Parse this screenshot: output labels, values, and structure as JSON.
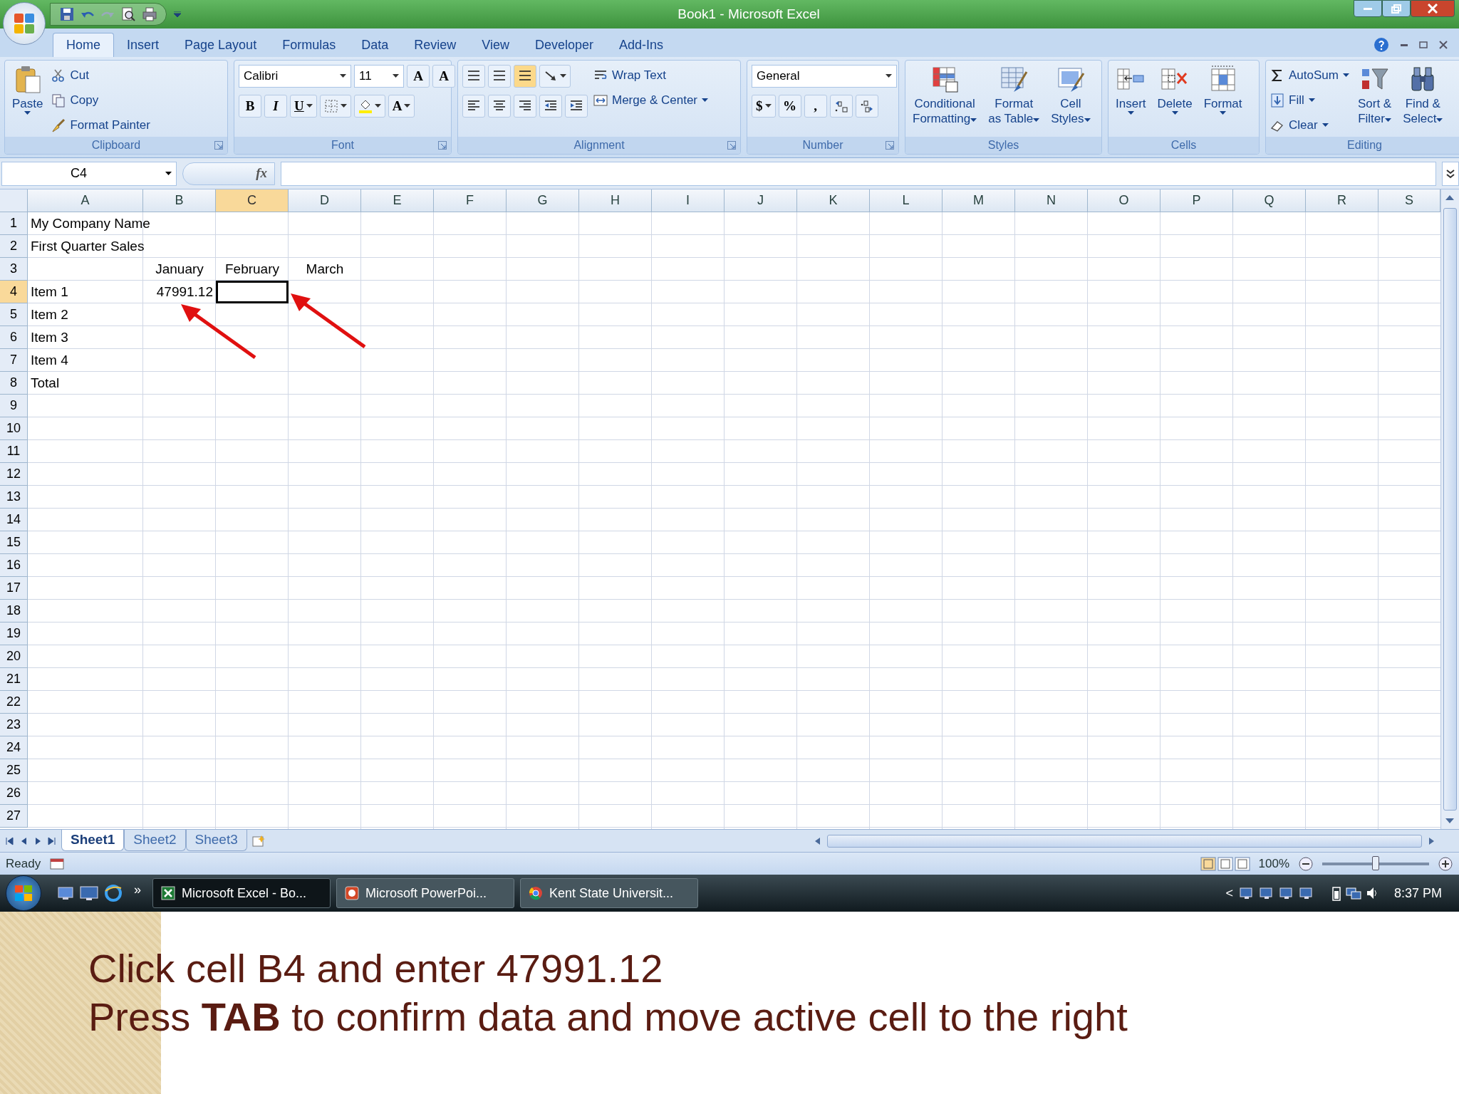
{
  "window": {
    "title": "Book1 - Microsoft Excel"
  },
  "tabs": [
    {
      "label": "Home",
      "selected": true
    },
    {
      "label": "Insert",
      "selected": false
    },
    {
      "label": "Page Layout",
      "selected": false
    },
    {
      "label": "Formulas",
      "selected": false
    },
    {
      "label": "Data",
      "selected": false
    },
    {
      "label": "Review",
      "selected": false
    },
    {
      "label": "View",
      "selected": false
    },
    {
      "label": "Developer",
      "selected": false
    },
    {
      "label": "Add-Ins",
      "selected": false
    }
  ],
  "ribbon": [
    {
      "label": "Clipboard",
      "launcher": true,
      "sections": [
        {
          "kind": "large",
          "lines": [
            "Paste"
          ],
          "dropdown": true
        },
        {
          "kind": "stack",
          "items": [
            {
              "label": "Cut",
              "dropdown": false
            },
            {
              "label": "Copy",
              "dropdown": false
            },
            {
              "label": "Format Painter",
              "dropdown": false
            }
          ]
        }
      ]
    },
    {
      "label": "Font",
      "launcher": true,
      "sections": [
        {
          "kind": "lines",
          "lines": [
            {
              "items": [
                {
                  "kind": "font-field",
                  "value": "Calibri"
                },
                {
                  "kind": "size-field",
                  "value": "11"
                },
                {
                  "kind": "glyph",
                  "text": "A",
                  "dropdown": false,
                  "selected": false
                },
                {
                  "kind": "glyph",
                  "text": "A",
                  "dropdown": false,
                  "selected": false
                }
              ]
            },
            {
              "items": [
                {
                  "kind": "glyph",
                  "text": "B",
                  "dropdown": false,
                  "selected": false
                },
                {
                  "kind": "glyph",
                  "text": "I",
                  "dropdown": false,
                  "selected": false
                },
                {
                  "kind": "glyph",
                  "text": "U",
                  "dropdown": true,
                  "selected": false
                },
                {
                  "kind": "icon",
                  "dropdown": true,
                  "selected": false
                },
                {
                  "kind": "icon",
                  "dropdown": true,
                  "selected": false
                },
                {
                  "kind": "glyph",
                  "text": "A",
                  "dropdown": true,
                  "selected": false
                }
              ]
            }
          ]
        }
      ]
    },
    {
      "label": "Alignment",
      "launcher": true,
      "sections": [
        {
          "kind": "lines",
          "lines": [
            {
              "items": [
                {
                  "kind": "icon",
                  "dropdown": false,
                  "selected": false
                },
                {
                  "kind": "icon",
                  "dropdown": false,
                  "selected": false
                },
                {
                  "kind": "icon",
                  "dropdown": false,
                  "selected": true
                },
                {
                  "kind": "icon",
                  "dropdown": true,
                  "selected": false
                }
              ]
            },
            {
              "items": [
                {
                  "kind": "icon",
                  "dropdown": false,
                  "selected": false
                },
                {
                  "kind": "icon",
                  "dropdown": false,
                  "selected": false
                },
                {
                  "kind": "icon",
                  "dropdown": false,
                  "selected": false
                },
                {
                  "kind": "icon",
                  "dropdown": false,
                  "selected": false
                },
                {
                  "kind": "icon",
                  "dropdown": false,
                  "selected": false
                }
              ]
            }
          ]
        },
        {
          "kind": "stack",
          "items": [
            {
              "label": "Wrap Text",
              "dropdown": false
            },
            {
              "label": "Merge & Center",
              "dropdown": true
            }
          ]
        }
      ]
    },
    {
      "label": "Number",
      "launcher": true,
      "sections": [
        {
          "kind": "lines",
          "lines": [
            {
              "items": [
                {
                  "kind": "format-field",
                  "value": "General"
                }
              ]
            },
            {
              "items": [
                {
                  "kind": "glyph",
                  "text": "$",
                  "dropdown": true,
                  "selected": false
                },
                {
                  "kind": "glyph",
                  "text": "%",
                  "dropdown": false,
                  "selected": false
                },
                {
                  "kind": "glyph",
                  "text": ",",
                  "dropdown": false,
                  "selected": false
                },
                {
                  "kind": "icon",
                  "dropdown": false,
                  "selected": false
                },
                {
                  "kind": "icon",
                  "dropdown": false,
                  "selected": false
                }
              ]
            }
          ]
        }
      ]
    },
    {
      "label": "Styles",
      "launcher": false,
      "sections": [
        {
          "kind": "large",
          "lines": [
            "Conditional",
            "Formatting"
          ],
          "dropdown": true
        },
        {
          "kind": "large",
          "lines": [
            "Format",
            "as Table"
          ],
          "dropdown": true
        },
        {
          "kind": "large",
          "lines": [
            "Cell",
            "Styles"
          ],
          "dropdown": true
        }
      ]
    },
    {
      "label": "Cells",
      "launcher": false,
      "sections": [
        {
          "kind": "large",
          "lines": [
            "Insert"
          ],
          "dropdown": true
        },
        {
          "kind": "large",
          "lines": [
            "Delete"
          ],
          "dropdown": true
        },
        {
          "kind": "large",
          "lines": [
            "Format"
          ],
          "dropdown": true
        }
      ]
    },
    {
      "label": "Editing",
      "launcher": false,
      "sections": [
        {
          "kind": "stack",
          "items": [
            {
              "label": "AutoSum",
              "dropdown": true
            },
            {
              "label": "Fill",
              "dropdown": true
            },
            {
              "label": "Clear",
              "dropdown": true
            }
          ]
        },
        {
          "kind": "large",
          "lines": [
            "Sort &",
            "Filter"
          ],
          "dropdown": true
        },
        {
          "kind": "large",
          "lines": [
            "Find &",
            "Select"
          ],
          "dropdown": true
        }
      ]
    }
  ],
  "formula_bar": {
    "name_box": "C4",
    "fx": "fx"
  },
  "columns": [
    {
      "label": "A",
      "selected": false
    },
    {
      "label": "B",
      "selected": false
    },
    {
      "label": "C",
      "selected": true
    },
    {
      "label": "D",
      "selected": false
    },
    {
      "label": "E",
      "selected": false
    },
    {
      "label": "F",
      "selected": false
    },
    {
      "label": "G",
      "selected": false
    },
    {
      "label": "H",
      "selected": false
    },
    {
      "label": "I",
      "selected": false
    },
    {
      "label": "J",
      "selected": false
    },
    {
      "label": "K",
      "selected": false
    },
    {
      "label": "L",
      "selected": false
    },
    {
      "label": "M",
      "selected": false
    },
    {
      "label": "N",
      "selected": false
    },
    {
      "label": "O",
      "selected": false
    },
    {
      "label": "P",
      "selected": false
    },
    {
      "label": "Q",
      "selected": false
    },
    {
      "label": "R",
      "selected": false
    },
    {
      "label": "S",
      "selected": false
    }
  ],
  "rows": [
    {
      "label": "1",
      "selected": false,
      "cells": {
        "A": {
          "text": "My Company Name"
        }
      }
    },
    {
      "label": "2",
      "selected": false,
      "cells": {
        "A": {
          "text": "First Quarter Sales"
        }
      }
    },
    {
      "label": "3",
      "selected": false,
      "cells": {
        "B": {
          "text": "January",
          "kind": "heading"
        },
        "C": {
          "text": "February",
          "kind": "heading"
        },
        "D": {
          "text": "March",
          "kind": "heading"
        }
      }
    },
    {
      "label": "4",
      "selected": true,
      "cells": {
        "A": {
          "text": "Item 1"
        },
        "B": {
          "text": "47991.12",
          "kind": "number"
        }
      }
    },
    {
      "label": "5",
      "selected": false,
      "cells": {
        "A": {
          "text": "Item 2"
        }
      }
    },
    {
      "label": "6",
      "selected": false,
      "cells": {
        "A": {
          "text": "Item 3"
        }
      }
    },
    {
      "label": "7",
      "selected": false,
      "cells": {
        "A": {
          "text": "Item 4"
        }
      }
    },
    {
      "label": "8",
      "selected": false,
      "cells": {
        "A": {
          "text": "Total"
        }
      }
    },
    {
      "label": "9",
      "selected": false
    },
    {
      "label": "10",
      "selected": false
    },
    {
      "label": "11",
      "selected": false
    },
    {
      "label": "12",
      "selected": false
    },
    {
      "label": "13",
      "selected": false
    },
    {
      "label": "14",
      "selected": false
    },
    {
      "label": "15",
      "selected": false
    },
    {
      "label": "16",
      "selected": false
    },
    {
      "label": "17",
      "selected": false
    },
    {
      "label": "18",
      "selected": false
    },
    {
      "label": "19",
      "selected": false
    },
    {
      "label": "20",
      "selected": false
    },
    {
      "label": "21",
      "selected": false
    },
    {
      "label": "22",
      "selected": false
    },
    {
      "label": "23",
      "selected": false
    },
    {
      "label": "24",
      "selected": false
    },
    {
      "label": "25",
      "selected": false
    },
    {
      "label": "26",
      "selected": false
    },
    {
      "label": "27",
      "selected": false
    }
  ],
  "sheet_tabs": [
    {
      "label": "Sheet1",
      "selected": true
    },
    {
      "label": "Sheet2",
      "selected": false
    },
    {
      "label": "Sheet3",
      "selected": false
    }
  ],
  "status_bar": {
    "text": "Ready",
    "zoom": "100%",
    "zoom_slider": {
      "level": 0.5
    }
  },
  "taskbar": {
    "overflow": "»",
    "tasks": [
      {
        "label": "Microsoft Excel - Bo...",
        "selected": true
      },
      {
        "label": "Microsoft PowerPoi...",
        "selected": false
      },
      {
        "label": "Kent State Universit...",
        "selected": false
      }
    ],
    "tray_arrow": "<",
    "clock": "8:37 PM"
  },
  "caption": {
    "lines": [
      "Click cell B4 and enter 47991.12",
      "Press **TAB** to confirm data and move active cell to the right"
    ]
  }
}
